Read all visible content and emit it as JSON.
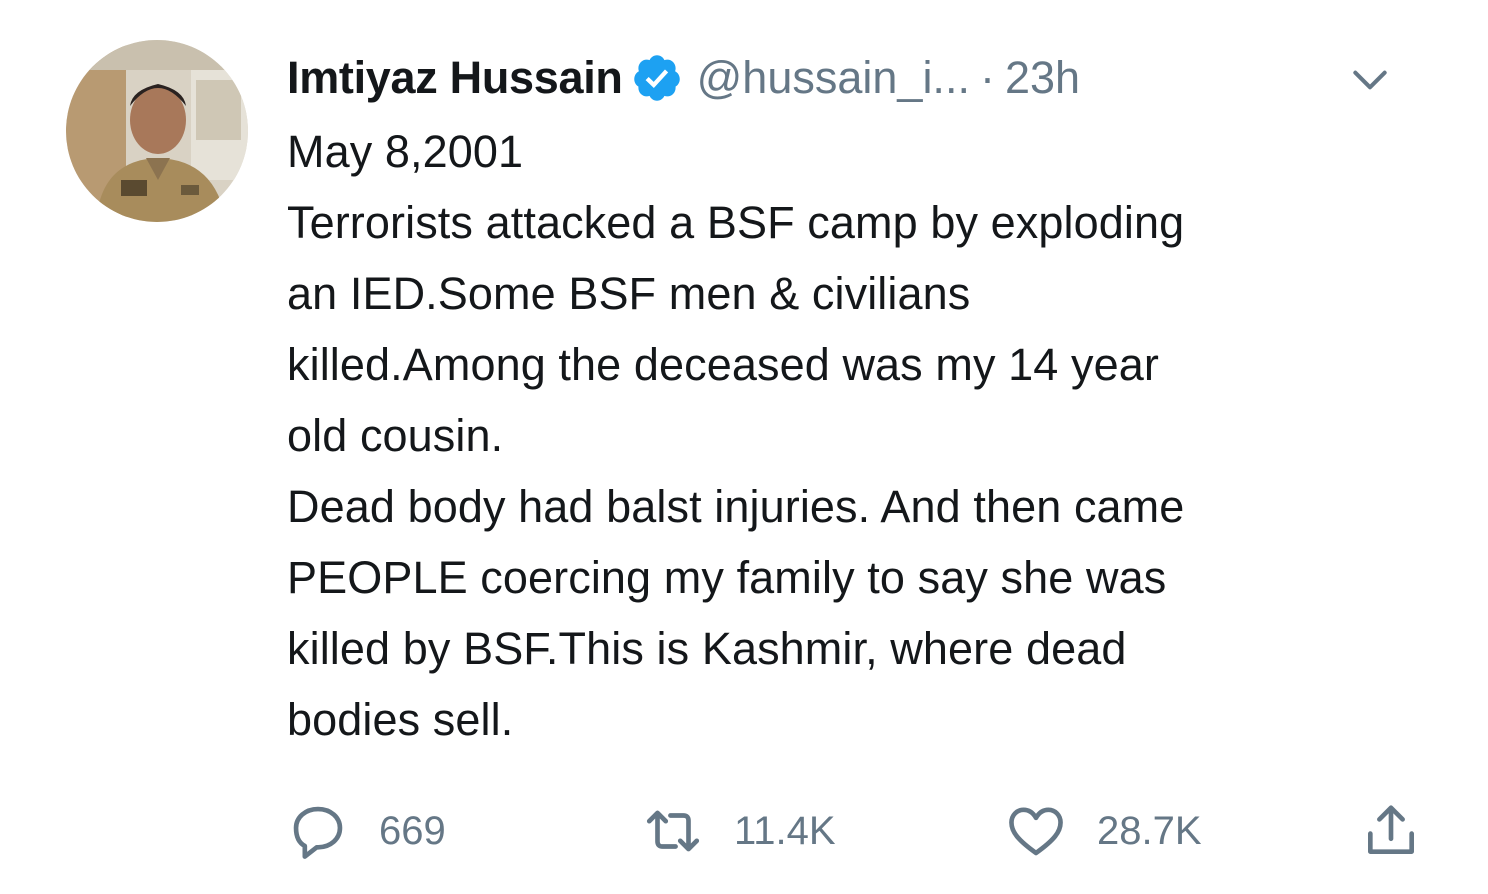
{
  "author": {
    "name": "Imtiyaz Hussain",
    "handle": "@hussain_i...",
    "separator": "·",
    "time": "23h",
    "verified": true
  },
  "tweet": {
    "lines": [
      "May 8,2001",
      "Terrorists attacked a BSF camp by exploding",
      "an IED.Some BSF men & civilians",
      "killed.Among the deceased was my 14 year",
      "old cousin.",
      "Dead body had balst injuries. And then came",
      "PEOPLE coercing my family to say she was",
      "killed by BSF.This is Kashmir, where dead",
      "bodies sell."
    ]
  },
  "actions": {
    "reply_count": "669",
    "retweet_count": "11.4K",
    "like_count": "28.7K"
  },
  "icons": {
    "verified": "verified-badge-icon",
    "menu": "chevron-down-icon",
    "reply": "reply-icon",
    "retweet": "retweet-icon",
    "like": "heart-icon",
    "share": "share-icon"
  },
  "colors": {
    "text": "#14171a",
    "secondary": "#657786",
    "verified_blue": "#1da1f2"
  }
}
